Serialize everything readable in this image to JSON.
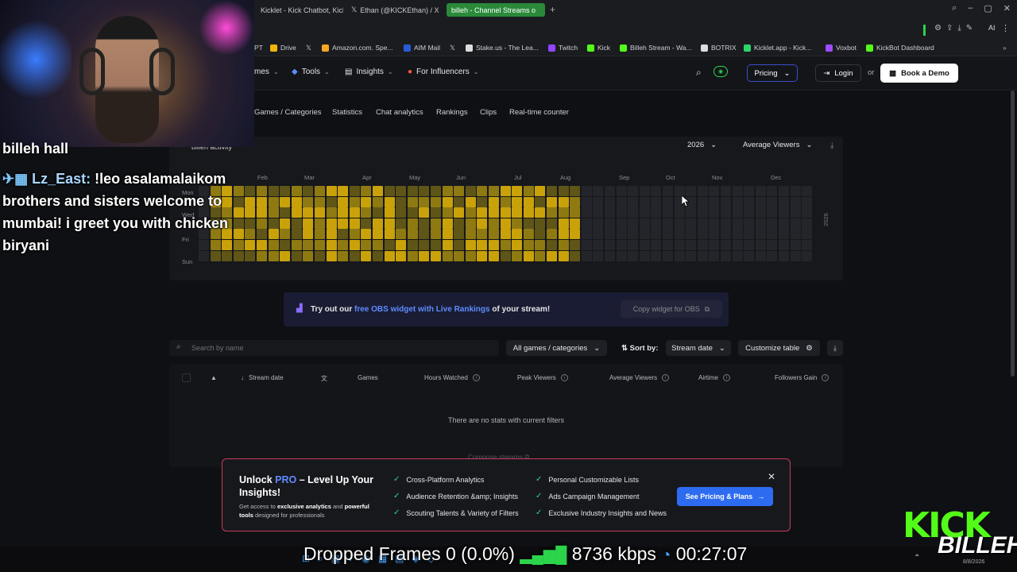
{
  "browser": {
    "tabs": [
      {
        "label": "Kicklet - Kick Chatbot, Kick",
        "active": false
      },
      {
        "label": "Ethan (@KICKEthan) / X",
        "active": false
      },
      {
        "label": "billeh - Channel Streams o",
        "active": true
      }
    ],
    "bookmarks": [
      {
        "label": "PT",
        "color": "#888"
      },
      {
        "label": "Drive",
        "color": "#f2b50f"
      },
      {
        "label": "",
        "color": "#ddd"
      },
      {
        "label": "Amazon.com. Spe...",
        "color": "#f5a623"
      },
      {
        "label": "AIM Mail",
        "color": "#2a5bd7"
      },
      {
        "label": "",
        "color": "#ddd"
      },
      {
        "label": "Stake.us - The Lea...",
        "color": "#ddd"
      },
      {
        "label": "Twitch",
        "color": "#9147ff"
      },
      {
        "label": "Kick",
        "color": "#53fc18"
      },
      {
        "label": "Billeh Stream - Wa...",
        "color": "#53fc18"
      },
      {
        "label": "BOTRIX",
        "color": "#ddd"
      },
      {
        "label": "Kicklet.app - Kick...",
        "color": "#2bd46a"
      },
      {
        "label": "Voxbot",
        "color": "#a04bff"
      },
      {
        "label": "KickBot Dashboard",
        "color": "#53fc18"
      }
    ]
  },
  "nav": {
    "items": [
      "mes",
      "Tools",
      "Insights",
      "For Influencers"
    ],
    "pricing": "Pricing",
    "login": "Login",
    "or": "or",
    "demo": "Book a Demo"
  },
  "subnav": [
    "Games / Categories",
    "Statistics",
    "Chat analytics",
    "Rankings",
    "Clips",
    "Real-time counter"
  ],
  "activity": {
    "title": "billeh activity",
    "year": "2026",
    "metric": "Average Viewers",
    "months": [
      "Jan",
      "Feb",
      "Mar",
      "Apr",
      "May",
      "Jun",
      "Jul",
      "Aug",
      "Sep",
      "Oct",
      "Nov",
      "Dec"
    ],
    "days": [
      "Mon",
      "Wed",
      "Fri",
      "Sun"
    ],
    "year_vertical": "2026",
    "colors": {
      "high": "#c9a20a",
      "mid": "#8f7a12",
      "low": "#5e5517",
      "empty": "#24252a"
    }
  },
  "promo": {
    "prefix": "Try out our ",
    "link": "free OBS widget with Live Rankings",
    "suffix": " of your stream!",
    "copy": "Copy widget for OBS"
  },
  "filters": {
    "search_placeholder": "Search by name",
    "games": "All games / categories",
    "sort_label": "Sort by:",
    "sort_value": "Stream date",
    "customize": "Customize table"
  },
  "table": {
    "columns": [
      "Stream date",
      "Games",
      "Hours Watched",
      "Peak Viewers",
      "Average Viewers",
      "Airtime",
      "Followers Gain"
    ],
    "empty": "There are no stats with current filters",
    "compose": "Compose streams"
  },
  "pro": {
    "title_prefix": "Unlock ",
    "title_highlight": "PRO",
    "title_suffix": " – Level Up Your Insights!",
    "sub_1": "Get access to ",
    "sub_b1": "exclusive analytics",
    "sub_2": " and ",
    "sub_b2": "powerful tools",
    "sub_3": " designed for professionals",
    "features_left": [
      "Cross-Platform Analytics",
      "Audience Retention &amp; Insights",
      "Scouting Talents & Variety of Filters"
    ],
    "features_right": [
      "Personal Customizable Lists",
      "Ads Campaign Management",
      "Exclusive Industry Insights and News"
    ],
    "cta": "See Pricing & Plans"
  },
  "overlay": {
    "chat_header": "billeh hall",
    "chat_user": "Lz_East:",
    "chat_message": " !leo asalamalaikom brothers and sisters welcome to mumbai! i greet you with chicken biryani",
    "obs_stats": "Dropped Frames 0 (0.0%)",
    "bitrate": "8736 kbps",
    "uptime": "00:27:07",
    "kick_logo": "KICK",
    "billeh_logo": "BILLEH",
    "date": "8/8/2026"
  }
}
